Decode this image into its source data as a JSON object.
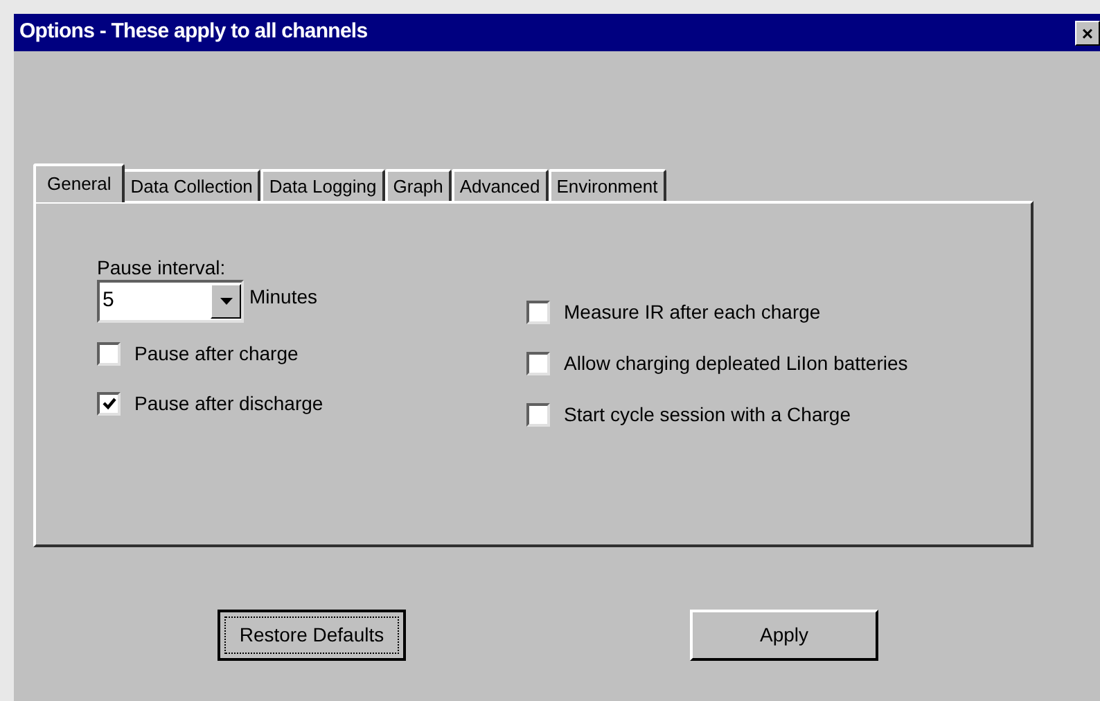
{
  "window": {
    "title": "Options - These apply to all channels",
    "close": "×"
  },
  "tabs": [
    {
      "label": "General",
      "selected": true
    },
    {
      "label": "Data Collection",
      "selected": false
    },
    {
      "label": "Data Logging",
      "selected": false
    },
    {
      "label": "Graph",
      "selected": false
    },
    {
      "label": "Advanced",
      "selected": false
    },
    {
      "label": "Environment",
      "selected": false
    }
  ],
  "pause_interval": {
    "label": "Pause interval:",
    "value": "5",
    "unit": "Minutes"
  },
  "left_options": [
    {
      "label": "Pause after charge",
      "checked": false
    },
    {
      "label": "Pause after discharge",
      "checked": true
    }
  ],
  "right_options": [
    {
      "label": "Measure IR after each charge",
      "checked": false
    },
    {
      "label": "Allow charging depleated LiIon batteries",
      "checked": false
    },
    {
      "label": "Start cycle session with a Charge",
      "checked": false
    }
  ],
  "buttons": [
    {
      "label": "Restore Defaults",
      "focused": true
    },
    {
      "label": "Apply",
      "focused": false
    }
  ]
}
